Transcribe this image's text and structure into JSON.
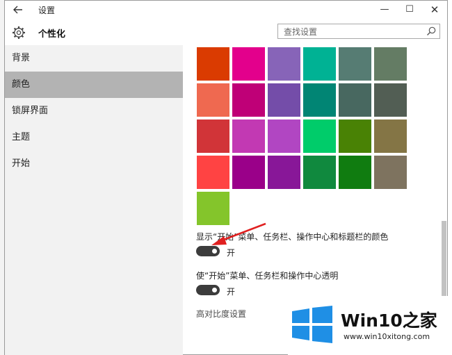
{
  "window": {
    "title": "设置",
    "back_icon": "arrow-left-icon",
    "minimize_glyph": "—",
    "maximize_glyph": "☐",
    "close_glyph": "✕"
  },
  "header": {
    "title": "个性化",
    "icon": "gear-icon"
  },
  "search": {
    "placeholder": "查找设置",
    "value": ""
  },
  "sidebar": {
    "items": [
      {
        "label": "背景",
        "active": false
      },
      {
        "label": "颜色",
        "active": true
      },
      {
        "label": "锁屏界面",
        "active": false
      },
      {
        "label": "主题",
        "active": false
      },
      {
        "label": "开始",
        "active": false
      }
    ]
  },
  "colors": {
    "rows": [
      [
        "#da3b01",
        "#e3008c",
        "#8764b8",
        "#00b294",
        "#567c73",
        "#647c64"
      ],
      [
        "#ef6950",
        "#bf0077",
        "#744da9",
        "#018574",
        "#486860",
        "#525e54"
      ],
      [
        "#d13438",
        "#c239b3",
        "#b146c2",
        "#00cc6a",
        "#498205",
        "#847545"
      ],
      [
        "#ff4343",
        "#9a0089",
        "#881798",
        "#10893e",
        "#107c10",
        "#7e735f"
      ],
      [
        "#84c52b"
      ]
    ]
  },
  "options": {
    "accent_on_surfaces": {
      "label": "显示“开始”菜单、任务栏、操作中心和标题栏的颜色",
      "state": "开"
    },
    "transparency": {
      "label": "使“开始”菜单、任务栏和操作中心透明",
      "state": "开"
    },
    "high_contrast_link": "高对比度设置"
  },
  "watermark": {
    "title": "Win10之家",
    "url": "www.win10xitong.com",
    "logo_color": "#1f8fe5"
  }
}
